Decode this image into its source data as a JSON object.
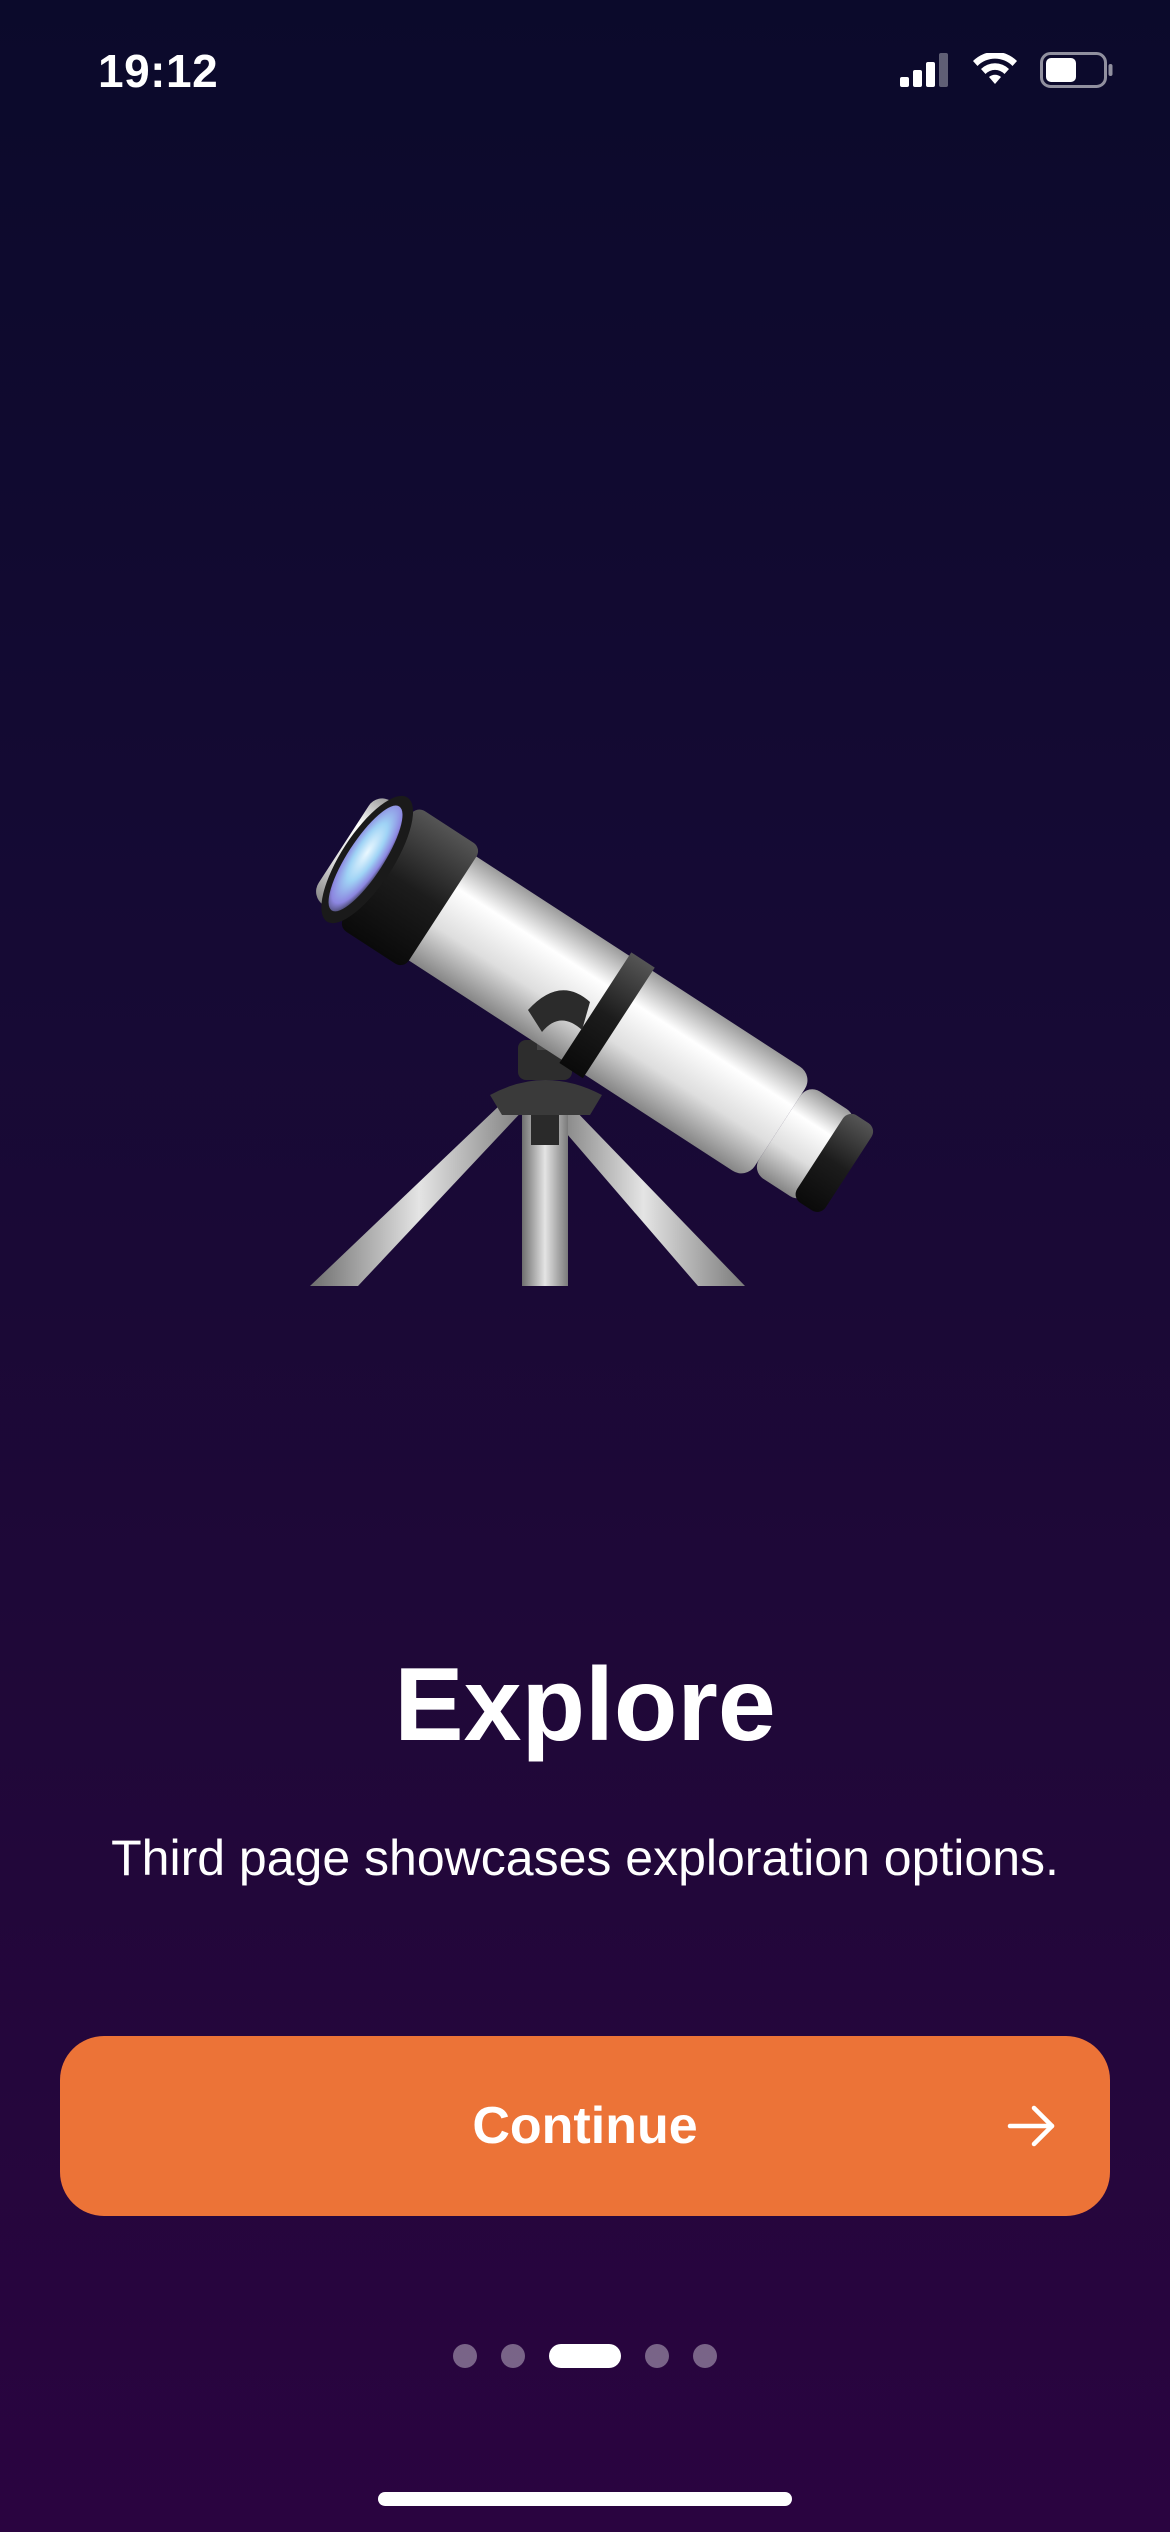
{
  "status_bar": {
    "time": "19:12",
    "signal_icon": "cellular-signal-icon",
    "wifi_icon": "wifi-icon",
    "battery_icon": "battery-icon",
    "battery_level": 0.55
  },
  "hero": {
    "icon": "telescope-icon"
  },
  "content": {
    "title": "Explore",
    "subtitle": "Third page showcases exploration options."
  },
  "continue_button": {
    "label": "Continue",
    "icon": "arrow-right-icon",
    "color": "#ec7337"
  },
  "page_indicator": {
    "total": 5,
    "current": 3
  },
  "colors": {
    "background_top": "#0b0a2b",
    "background_bottom": "#2a0440",
    "accent": "#ec7337"
  }
}
